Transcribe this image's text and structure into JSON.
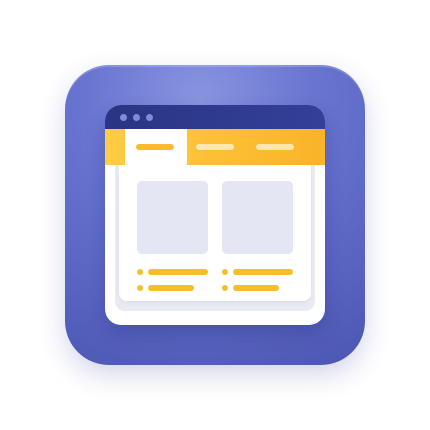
{
  "icon": {
    "name": "web-page-layout-icon",
    "tile_color": "#6571cf",
    "titlebar_color": "#2b3685",
    "accent_color": "#fbbc2c",
    "card_color": "#e4e7f3",
    "window_dots": 3,
    "inactive_tabs": 2,
    "cards": 2,
    "list_rows_per_card": 2
  }
}
